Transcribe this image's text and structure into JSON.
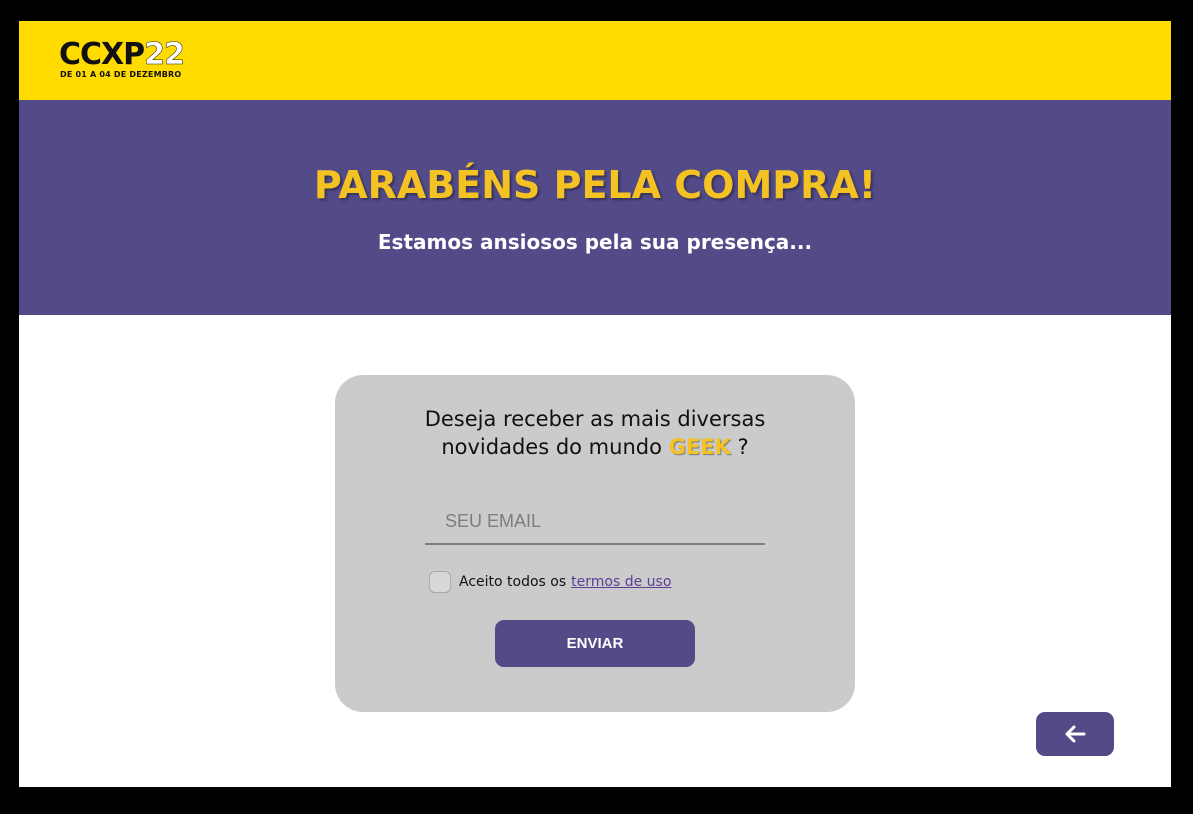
{
  "header": {
    "logo_main": "CCXP",
    "logo_year": "22",
    "logo_dates": "DE 01 A 04 DE DEZEMBRO",
    "background_color": "#ffdb00"
  },
  "hero": {
    "title": "PARABÉNS PELA COMPRA!",
    "subtitle": "Estamos ansiosos pela sua presença...",
    "background_color": "#524b88",
    "title_color": "#f5c223"
  },
  "newsletter": {
    "question_line1": "Deseja receber as mais diversas",
    "question_line2_prefix": "novidades do mundo ",
    "question_highlight": "GEEK",
    "question_suffix": " ?",
    "email_placeholder": "SEU EMAIL",
    "email_value": "",
    "terms_text": "Aceito todos os",
    "terms_link": "termos de uso",
    "terms_checked": false,
    "submit_label": "ENVIAR"
  },
  "back_button": {
    "icon": "arrow-left-icon"
  }
}
